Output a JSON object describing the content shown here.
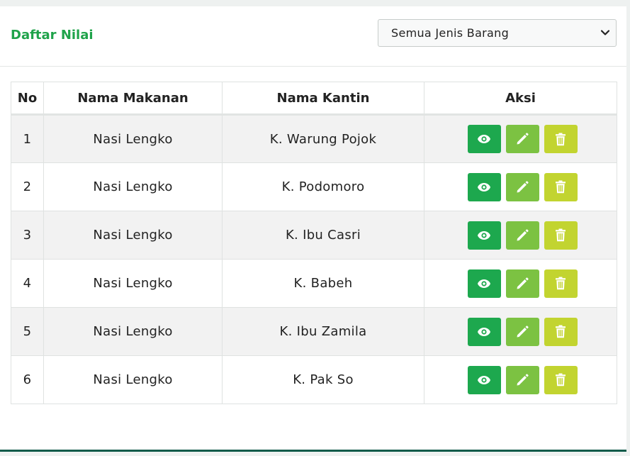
{
  "header": {
    "title": "Daftar Nilai",
    "filter": {
      "selected": "Semua Jenis Barang"
    }
  },
  "table": {
    "columns": [
      "No",
      "Nama Makanan",
      "Nama Kantin",
      "Aksi"
    ],
    "rows": [
      {
        "no": "1",
        "makanan": "Nasi Lengko",
        "kantin": "K. Warung Pojok"
      },
      {
        "no": "2",
        "makanan": "Nasi Lengko",
        "kantin": "K. Podomoro"
      },
      {
        "no": "3",
        "makanan": "Nasi Lengko",
        "kantin": "K. Ibu Casri"
      },
      {
        "no": "4",
        "makanan": "Nasi Lengko",
        "kantin": "K. Babeh"
      },
      {
        "no": "5",
        "makanan": "Nasi Lengko",
        "kantin": "K. Ibu Zamila"
      },
      {
        "no": "6",
        "makanan": "Nasi Lengko",
        "kantin": "K. Pak So"
      }
    ],
    "actions": {
      "view": "eye-icon",
      "edit": "pencil-icon",
      "delete": "trash-icon"
    }
  },
  "colors": {
    "title": "#1fa34a",
    "view": "#1da84e",
    "edit": "#7cc242",
    "delete": "#c2d430"
  }
}
